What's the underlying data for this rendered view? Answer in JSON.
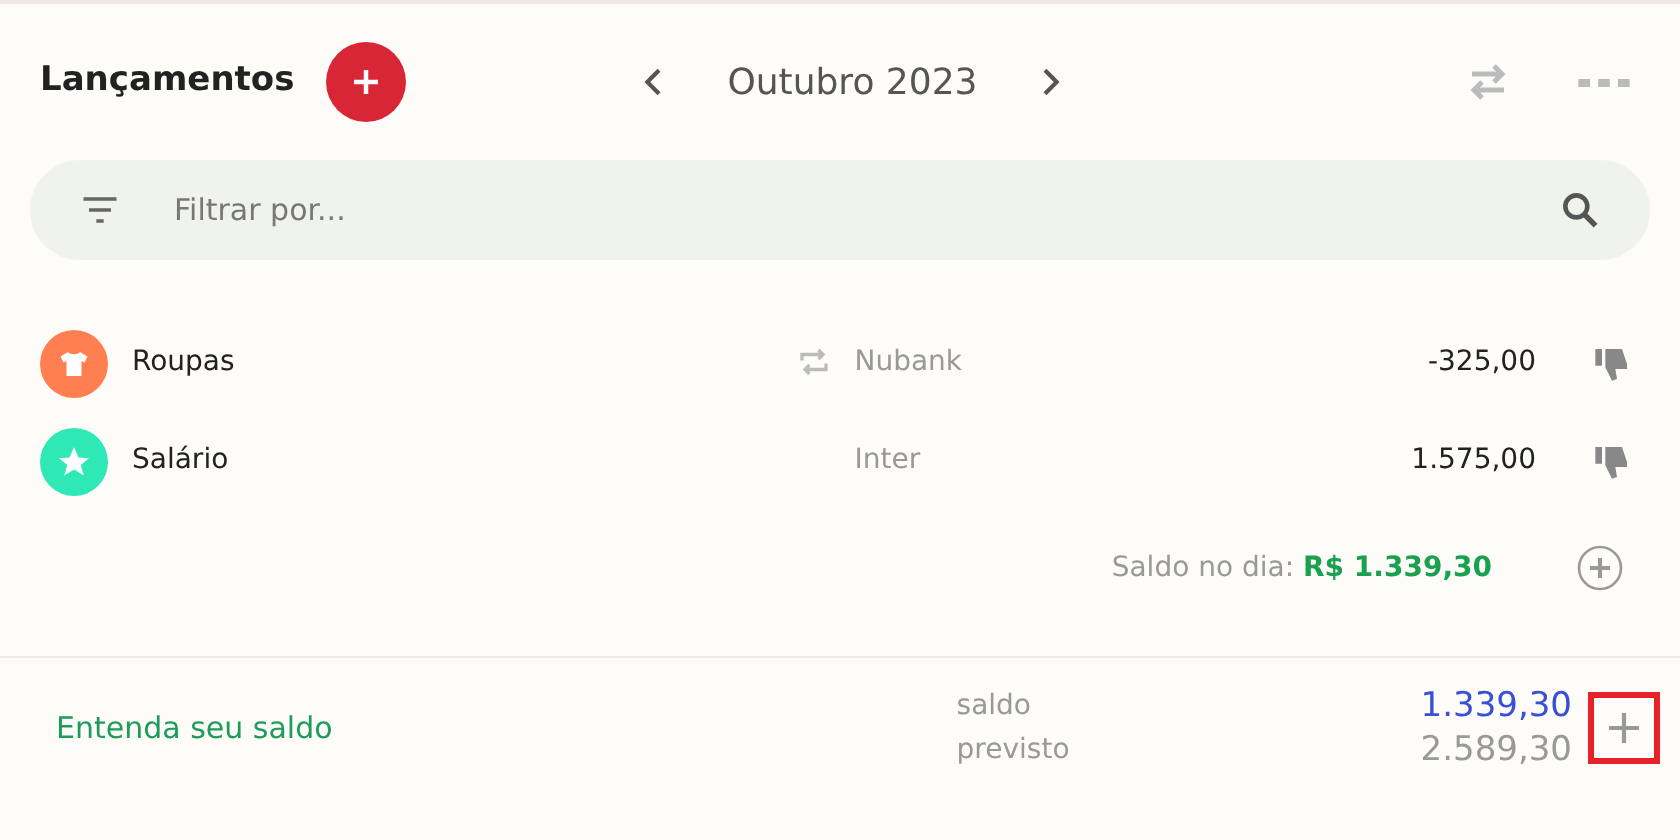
{
  "header": {
    "title": "Lançamentos",
    "month": "Outubro 2023"
  },
  "filter": {
    "placeholder": "Filtrar por..."
  },
  "transactions": [
    {
      "category": "Roupas",
      "kind": "shirt",
      "color": "#ff7f50",
      "recurring": true,
      "account": "Nubank",
      "amount": "-325,00"
    },
    {
      "category": "Salário",
      "kind": "star",
      "color": "#2ee8b6",
      "recurring": false,
      "account": "Inter",
      "amount": "1.575,00"
    }
  ],
  "day_balance": {
    "label": "Saldo no dia:",
    "value": "R$ 1.339,30"
  },
  "footer": {
    "link": "Entenda seu saldo",
    "balance_label": "saldo",
    "balance": "1.339,30",
    "forecast_label": "previsto",
    "forecast": "2.589,30"
  }
}
